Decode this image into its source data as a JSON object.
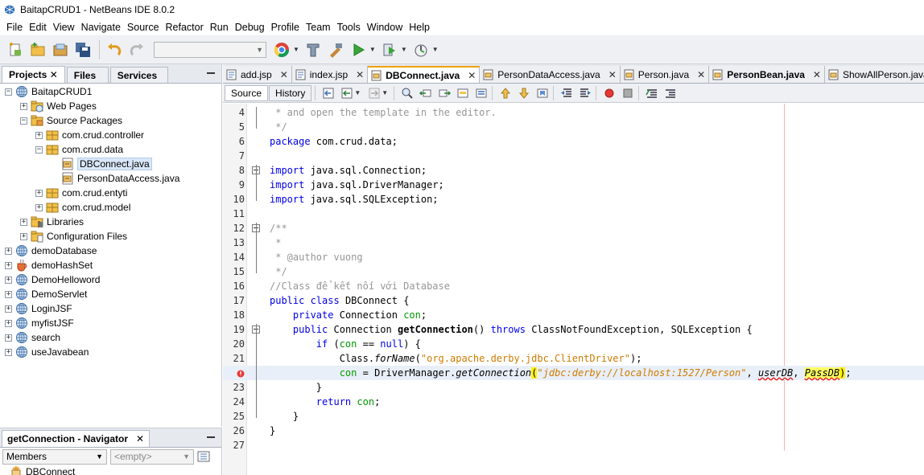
{
  "window": {
    "title": "BaitapCRUD1 - NetBeans IDE 8.0.2"
  },
  "menu": [
    "File",
    "Edit",
    "View",
    "Navigate",
    "Source",
    "Refactor",
    "Run",
    "Debug",
    "Profile",
    "Team",
    "Tools",
    "Window",
    "Help"
  ],
  "toolbar": {
    "icons": [
      "new-file-icon",
      "new-project-icon",
      "open-project-icon",
      "save-all-icon",
      "undo-icon",
      "redo-icon",
      "config-combo",
      "browser-icon",
      "clean-build-icon",
      "build-icon",
      "run-icon",
      "debug-icon",
      "profile-icon"
    ],
    "config_value": ""
  },
  "project_panel": {
    "tabs": [
      "Projects",
      "Files",
      "Services"
    ],
    "tree": [
      {
        "label": "BaitapCRUD1",
        "level": 0,
        "exp": "−",
        "icon": "globe"
      },
      {
        "label": "Web Pages",
        "level": 1,
        "exp": "+",
        "icon": "webfolder"
      },
      {
        "label": "Source Packages",
        "level": 1,
        "exp": "−",
        "icon": "srcfolder"
      },
      {
        "label": "com.crud.controller",
        "level": 2,
        "exp": "+",
        "icon": "package"
      },
      {
        "label": "com.crud.data",
        "level": 2,
        "exp": "−",
        "icon": "package"
      },
      {
        "label": "DBConnect.java",
        "level": 3,
        "exp": "",
        "icon": "java",
        "selected": true
      },
      {
        "label": "PersonDataAccess.java",
        "level": 3,
        "exp": "",
        "icon": "java"
      },
      {
        "label": "com.crud.entyti",
        "level": 2,
        "exp": "+",
        "icon": "package"
      },
      {
        "label": "com.crud.model",
        "level": 2,
        "exp": "+",
        "icon": "package"
      },
      {
        "label": "Libraries",
        "level": 1,
        "exp": "+",
        "icon": "libfolder"
      },
      {
        "label": "Configuration Files",
        "level": 1,
        "exp": "+",
        "icon": "cfgfolder"
      },
      {
        "label": "demoDatabase",
        "level": 0,
        "exp": "+",
        "icon": "globe"
      },
      {
        "label": "demoHashSet",
        "level": 0,
        "exp": "+",
        "icon": "cup"
      },
      {
        "label": "DemoHelloword",
        "level": 0,
        "exp": "+",
        "icon": "globe"
      },
      {
        "label": "DemoServlet",
        "level": 0,
        "exp": "+",
        "icon": "globe"
      },
      {
        "label": "LoginJSF",
        "level": 0,
        "exp": "+",
        "icon": "globe"
      },
      {
        "label": "myfistJSF",
        "level": 0,
        "exp": "+",
        "icon": "globe"
      },
      {
        "label": "search",
        "level": 0,
        "exp": "+",
        "icon": "globe"
      },
      {
        "label": "useJavabean",
        "level": 0,
        "exp": "+",
        "icon": "globe"
      }
    ]
  },
  "navigator": {
    "title": "getConnection - Navigator",
    "members_label": "Members",
    "filter_value": "<empty>",
    "first_item": "DBConnect"
  },
  "editor": {
    "tabs": [
      {
        "label": "add.jsp",
        "icon": "jsp"
      },
      {
        "label": "index.jsp",
        "icon": "jsp"
      },
      {
        "label": "DBConnect.java",
        "icon": "java",
        "active": true
      },
      {
        "label": "PersonDataAccess.java",
        "icon": "java"
      },
      {
        "label": "Person.java",
        "icon": "java"
      },
      {
        "label": "PersonBean.java",
        "icon": "java",
        "bold": true
      },
      {
        "label": "ShowAllPerson.java",
        "icon": "java"
      }
    ],
    "source_tab": "Source",
    "history_tab": "History",
    "lines": [
      {
        "n": "4",
        "t": "cm",
        "text": " * and open the template in the editor."
      },
      {
        "n": "5",
        "t": "cm",
        "text": " */"
      },
      {
        "n": "6",
        "t": "pkg",
        "kw": "package",
        "rest": " com.crud.data;"
      },
      {
        "n": "7",
        "t": "blank",
        "text": ""
      },
      {
        "n": "8",
        "t": "imp",
        "kw": "import",
        "rest": " java.sql.Connection;"
      },
      {
        "n": "9",
        "t": "imp",
        "kw": "import",
        "rest": " java.sql.DriverManager;"
      },
      {
        "n": "10",
        "t": "imp",
        "kw": "import",
        "rest": " java.sql.SQLException;"
      },
      {
        "n": "11",
        "t": "blank",
        "text": ""
      },
      {
        "n": "12",
        "t": "cm",
        "text": "/**"
      },
      {
        "n": "13",
        "t": "cm",
        "text": " *"
      },
      {
        "n": "14",
        "t": "cm",
        "text": " * @author vuong"
      },
      {
        "n": "15",
        "t": "cm",
        "text": " */"
      },
      {
        "n": "16",
        "t": "cm",
        "text": "//Class để kết nối với Database"
      },
      {
        "n": "17",
        "t": "cls",
        "text": ""
      },
      {
        "n": "18",
        "t": "fld",
        "text": ""
      },
      {
        "n": "19",
        "t": "mth",
        "text": ""
      },
      {
        "n": "20",
        "t": "if",
        "text": ""
      },
      {
        "n": "21",
        "t": "forname",
        "text": ""
      },
      {
        "n": "",
        "t": "getconn",
        "text": ""
      },
      {
        "n": "23",
        "t": "close2",
        "text": ""
      },
      {
        "n": "24",
        "t": "ret",
        "text": ""
      },
      {
        "n": "25",
        "t": "close1",
        "text": ""
      },
      {
        "n": "26",
        "t": "close0",
        "text": ""
      },
      {
        "n": "27",
        "t": "blank",
        "text": ""
      }
    ],
    "code": {
      "pkg_kw": "package",
      "imp_kw": "import",
      "public": "public",
      "class": "class",
      "private": "private",
      "throws": "throws",
      "if": "if",
      "null": "null",
      "return": "return",
      "class_name": "DBConnect",
      "conn_type": "Connection",
      "field": "con",
      "method": "getConnection",
      "exc": "ClassNotFoundException, SQLException",
      "forname_call": "Class.",
      "forname": "forName",
      "driver": "\"org.apache.derby.jdbc.ClientDriver\"",
      "dm": "DriverManager.",
      "url": "\"jdbc:derby://localhost:1527/Person\"",
      "user": "userDB",
      "pass": "PassDB"
    }
  }
}
